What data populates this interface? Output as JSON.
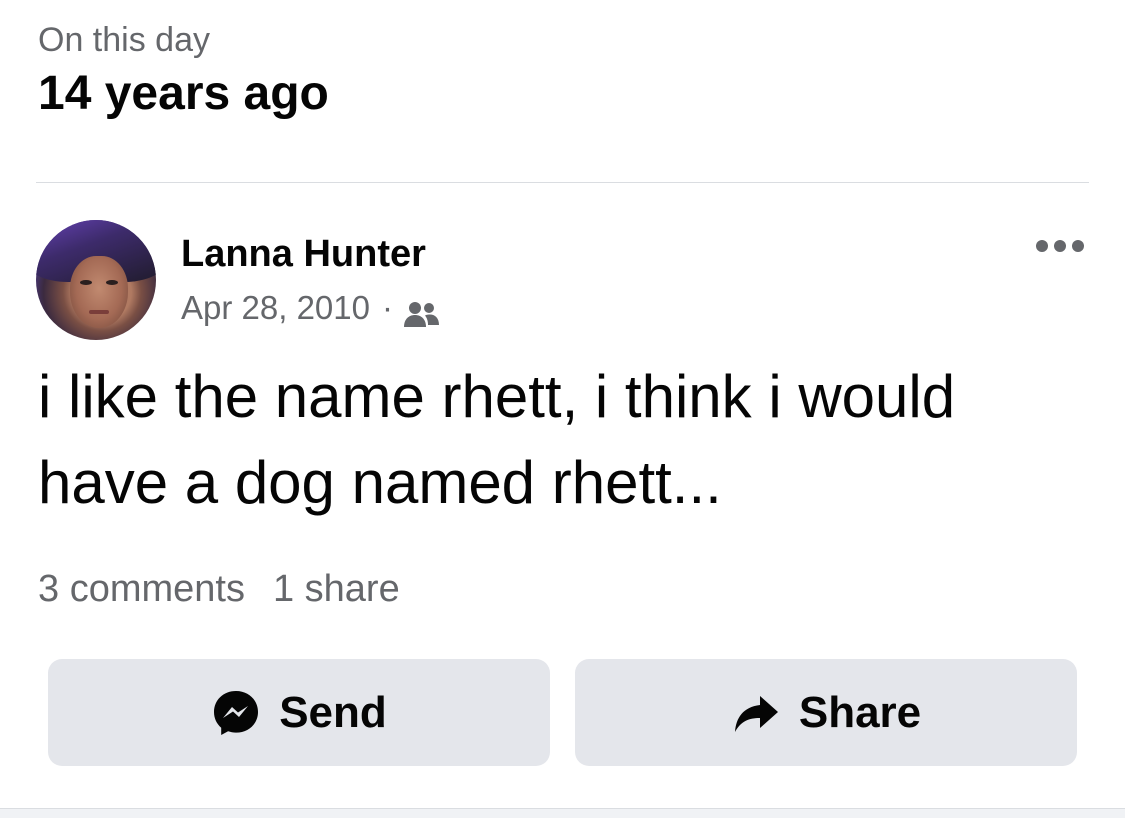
{
  "memory": {
    "kicker": "On this day",
    "years_ago": "14 years ago"
  },
  "post": {
    "author": "Lanna Hunter",
    "date": "Apr 28, 2010",
    "separator": "·",
    "audience_icon": "friends-icon",
    "text": "i like the name rhett, i think i would have a dog named rhett...",
    "comments": "3 comments",
    "shares": "1 share"
  },
  "actions": {
    "send_label": "Send",
    "send_icon": "messenger-icon",
    "share_label": "Share",
    "share_icon": "share-arrow-icon"
  },
  "colors": {
    "secondary_text": "#65676b",
    "button_bg": "#e4e6eb",
    "primary_text": "#050505"
  }
}
